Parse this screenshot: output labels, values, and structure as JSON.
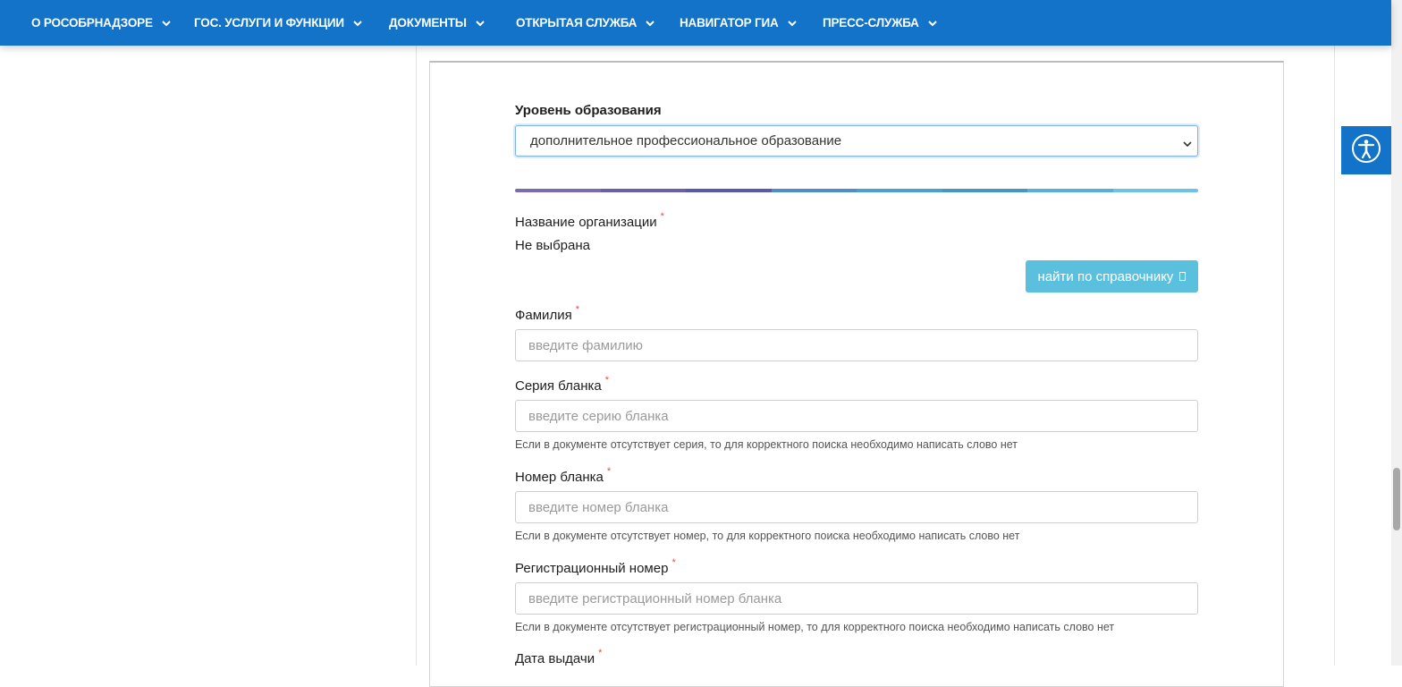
{
  "nav": {
    "items": [
      {
        "label": "О РОСОБРНАДЗОРЕ"
      },
      {
        "label": "ГОС. УСЛУГИ И ФУНКЦИИ"
      },
      {
        "label": "ДОКУМЕНТЫ"
      },
      {
        "label": "ОТКРЫТАЯ СЛУЖБА"
      },
      {
        "label": "НАВИГАТОР ГИА"
      },
      {
        "label": "ПРЕСС-СЛУЖБА"
      }
    ]
  },
  "form": {
    "education_level": {
      "label": "Уровень образования",
      "selected": "дополнительное профессиональное образование"
    },
    "organization": {
      "label": "Название организации",
      "required_mark": "*",
      "value": "Не выбрана",
      "find_button": "найти по справочнику"
    },
    "surname": {
      "label": "Фамилия",
      "required_mark": "*",
      "placeholder": "введите фамилию"
    },
    "series": {
      "label": "Серия бланка",
      "required_mark": "*",
      "placeholder": "введите серию бланка",
      "hint": "Если в документе отсутствует серия, то для корректного поиска необходимо написать слово нет"
    },
    "number": {
      "label": "Номер бланка",
      "required_mark": "*",
      "placeholder": "введите номер бланка",
      "hint": "Если в документе отсутствует номер, то для корректного поиска необходимо написать слово нет"
    },
    "reg_number": {
      "label": "Регистрационный номер",
      "required_mark": "*",
      "placeholder": "введите регистрационный номер бланка",
      "hint": "Если в документе отсутствует регистрационный номер, то для корректного поиска необходимо написать слово нет"
    },
    "issue_date": {
      "label": "Дата выдачи",
      "required_mark": "*"
    }
  },
  "colors": {
    "nav_bg": "#1273c9",
    "button_bg": "#5bc0de",
    "required": "#e74c3c",
    "progress": [
      "#7b6bb5",
      "#6a5fae",
      "#5b5aaa",
      "#4f8dc9",
      "#4a9fd3",
      "#4596c7",
      "#57b0dc",
      "#6cc3e6"
    ]
  },
  "icons": {
    "nav_chevron": "chevron-down-icon",
    "a11y": "accessibility-icon"
  }
}
